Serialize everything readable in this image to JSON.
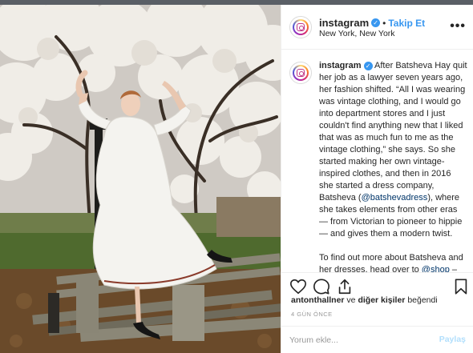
{
  "post": {
    "author": "instagram",
    "follow_label": "Takip Et",
    "separator": "•",
    "location": "New York, New York",
    "more_label": "•••",
    "caption_p1": "After Batsheva Hay quit her job as a lawyer seven years ago, her fashion shifted. “All I was wearing was vintage clothing, and I would go into department stores and I just couldn't find anything new that I liked that was as much fun to me as the vintage clothing,” she says. So she started making her own vintage-inspired clothes, and then in 2016 she started a dress company, Batsheva (",
    "caption_mention1": "@batshevadress",
    "caption_p1_end": "), where she takes elements from other eras — from Victorian to pioneer to hippie — and gives them a modern twist.",
    "caption_p2": "To find out more about Batsheva and her dresses, head over to ",
    "caption_mention2": "@shop",
    "caption_p2_end": " – THE account where you can discover and shop from us and coming",
    "likes_user": "antonthallner",
    "likes_mid": " ve ",
    "likes_others": "diğer kişiler",
    "likes_end": " beğendi",
    "time_ago": "4 GÜN ÖNCE",
    "comment_placeholder": "Yorum ekle...",
    "post_label": "Paylaş"
  },
  "colors": {
    "link_blue": "#3897f0",
    "mention": "#003569",
    "post_button_disabled": "#b2dffc"
  },
  "icons": [
    "instagram-logo-icon",
    "verified-badge-icon",
    "heart-icon",
    "comment-icon",
    "share-icon",
    "bookmark-icon",
    "more-options-icon"
  ]
}
